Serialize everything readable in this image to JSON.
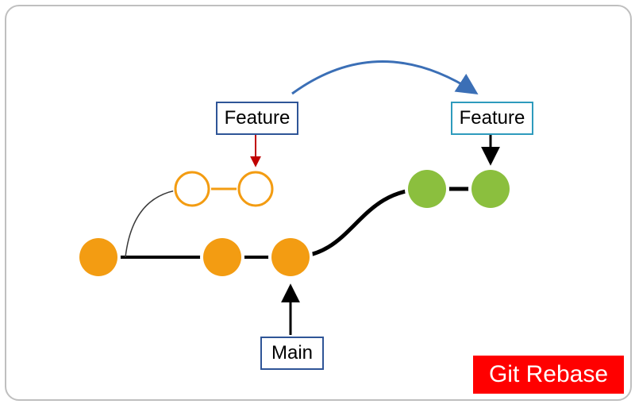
{
  "title": "Git Rebase",
  "labels": {
    "feature_old": "Feature",
    "feature_new": "Feature",
    "main": "Main"
  },
  "colors": {
    "main_commit_fill": "#f39c12",
    "main_commit_stroke": "#ffffff",
    "old_feature_stroke": "#f39c12",
    "new_feature_fill": "#8bbf3e",
    "connector": "#000000",
    "thin_connector": "#3a3a3a",
    "feature_old_border": "#2f5597",
    "feature_new_border": "#2e9bbd",
    "main_border": "#2f5597",
    "pointer_old": "#c00000",
    "pointer_new": "#000000",
    "pointer_main": "#000000",
    "arc": "#3b6fb6",
    "title_bg": "#ff0000"
  },
  "chart_data": {
    "type": "diagram",
    "description": "Git rebase diagram: a main branch of 3 commits; an original feature branch (2 commits) forked from commit 1 is replayed on top of main's tip, becoming 2 new commits.",
    "main_branch": {
      "label": "Main",
      "commits": [
        "m1",
        "m2",
        "m3"
      ],
      "tip": "m3"
    },
    "feature_before": {
      "label": "Feature",
      "base": "m1",
      "commits": [
        "f1_old",
        "f2_old"
      ],
      "state": "original (hollow)"
    },
    "feature_after": {
      "label": "Feature",
      "base": "m3",
      "commits": [
        "f1_new",
        "f2_new"
      ],
      "state": "rebased (solid)"
    },
    "arrows": [
      {
        "from_label": "Feature (old)",
        "to": "f2_old"
      },
      {
        "from_label": "Feature (new)",
        "to": "f2_new"
      },
      {
        "from_label": "Main",
        "to": "m3"
      },
      {
        "from_label": "rebase-arc",
        "to": "Feature new position"
      }
    ]
  }
}
